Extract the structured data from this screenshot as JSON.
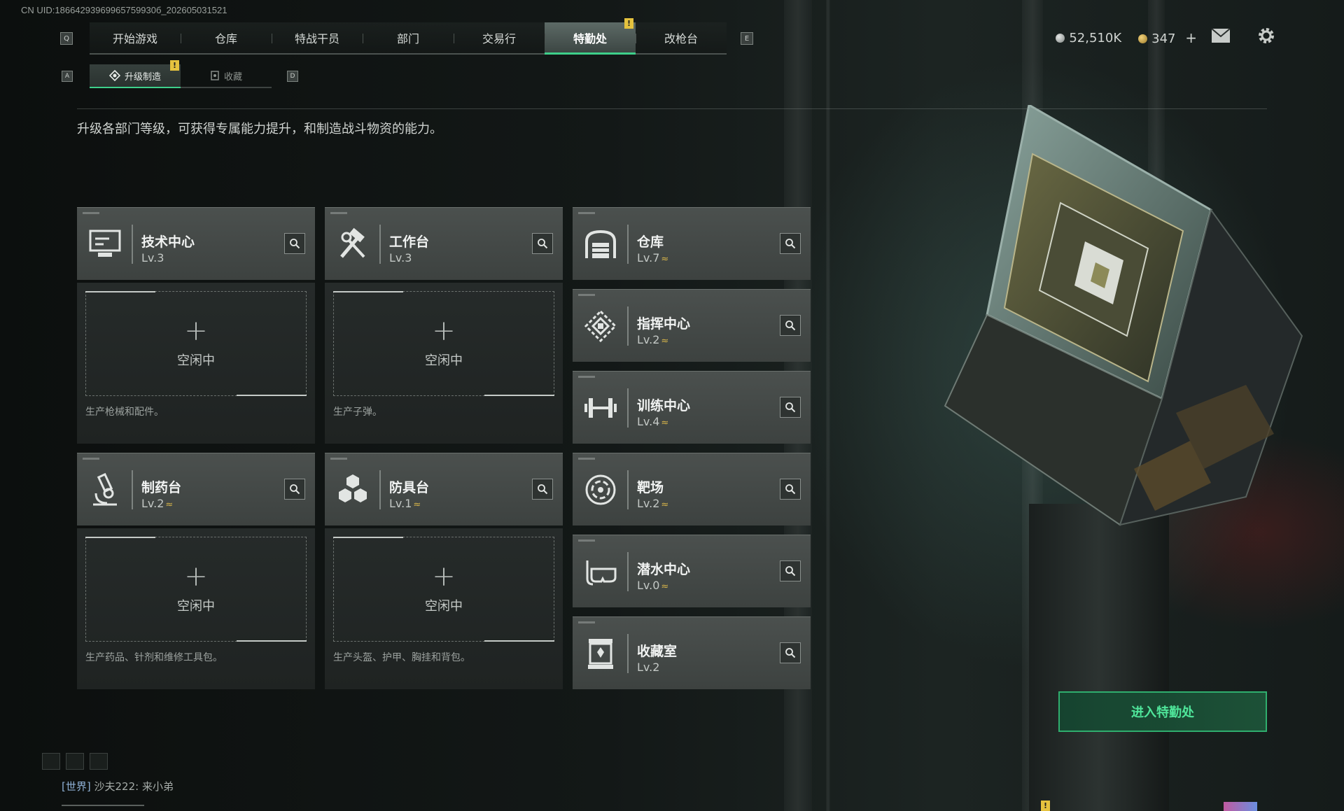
{
  "uid": "CN UID:18664293969965759930б_202605031521",
  "nav": {
    "tabs": [
      {
        "label": "开始游戏",
        "key": ""
      },
      {
        "label": "仓库"
      },
      {
        "label": "特战干员"
      },
      {
        "label": "部门"
      },
      {
        "label": "交易行"
      },
      {
        "label": "特勤处"
      },
      {
        "label": "改枪台"
      }
    ],
    "active_index": 5,
    "badge": "!",
    "key_left": "Q",
    "key_right": "E"
  },
  "currency": {
    "silver": "52,510K",
    "gold": "347",
    "add": "+"
  },
  "subtabs": {
    "items": [
      {
        "label": "升级制造"
      },
      {
        "label": "收藏"
      }
    ],
    "badge": "!",
    "key_left": "A",
    "key_right": "D"
  },
  "description": "升级各部门等级，可获得专属能力提升，和制造战斗物资的能力。",
  "stations": {
    "tech": {
      "name": "技术中心",
      "level": "Lv.3",
      "idle": "空闲中",
      "desc": "生产枪械和配件。"
    },
    "workbench": {
      "name": "工作台",
      "level": "Lv.3",
      "idle": "空闲中",
      "desc": "生产子弹。"
    },
    "pharmacy": {
      "name": "制药台",
      "level": "Lv.2",
      "idle": "空闲中",
      "desc": "生产药品、针剂和维修工具包。"
    },
    "armor": {
      "name": "防具台",
      "level": "Lv.1",
      "idle": "空闲中",
      "desc": "生产头盔、护甲、胸挂和背包。"
    }
  },
  "departments": [
    {
      "name": "仓库",
      "level": "Lv.7",
      "upgradable": true
    },
    {
      "name": "指挥中心",
      "level": "Lv.2",
      "upgradable": true
    },
    {
      "name": "训练中心",
      "level": "Lv.4",
      "upgradable": true
    },
    {
      "name": "靶场",
      "level": "Lv.2",
      "upgradable": true
    },
    {
      "name": "潜水中心",
      "level": "Lv.0",
      "upgradable": true
    },
    {
      "name": "收藏室",
      "level": "Lv.2",
      "upgradable": false
    }
  ],
  "upgrade_glyph": "≈",
  "plus_glyph": "+",
  "enter_button": "进入特勤处",
  "chat": {
    "channel": "[世界]",
    "message": "沙夫222: 来小弟"
  },
  "colors": {
    "accent": "#3ecf8a",
    "badge": "#e5c23e",
    "upgrade": "#d9b64a"
  }
}
